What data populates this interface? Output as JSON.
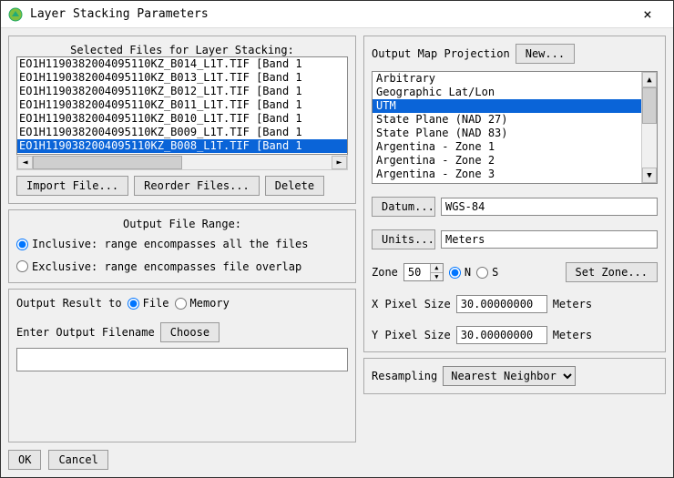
{
  "window": {
    "title": "Layer Stacking Parameters",
    "close": "×"
  },
  "left": {
    "files_heading": "Selected Files for Layer Stacking:",
    "files": [
      "EO1H1190382004095110KZ_B014_L1T.TIF [Band 1",
      "EO1H1190382004095110KZ_B013_L1T.TIF [Band 1",
      "EO1H1190382004095110KZ_B012_L1T.TIF [Band 1",
      "EO1H1190382004095110KZ_B011_L1T.TIF [Band 1",
      "EO1H1190382004095110KZ_B010_L1T.TIF [Band 1",
      "EO1H1190382004095110KZ_B009_L1T.TIF [Band 1",
      "EO1H1190382004095110KZ_B008_L1T.TIF [Band 1"
    ],
    "selected_file_index": 6,
    "import": "Import File...",
    "reorder": "Reorder Files...",
    "delete": "Delete",
    "range_heading": "Output File Range:",
    "range_inclusive": "Inclusive: range encompasses all the files",
    "range_exclusive": "Exclusive: range encompasses file overlap",
    "range_selected": "inclusive",
    "output_to_label": "Output Result to",
    "output_file": "File",
    "output_memory": "Memory",
    "output_selected": "file",
    "enter_filename_label": "Enter Output Filename",
    "choose": "Choose",
    "filename_value": ""
  },
  "right": {
    "projection_label": "Output Map Projection",
    "new_btn": "New...",
    "projections": [
      "Arbitrary",
      "Geographic Lat/Lon",
      "UTM",
      "State Plane (NAD 27)",
      "State Plane (NAD 83)",
      "Argentina - Zone 1",
      "Argentina - Zone 2",
      "Argentina - Zone 3"
    ],
    "projection_selected_index": 2,
    "datum_btn": "Datum...",
    "datum_value": "WGS-84",
    "units_btn": "Units...",
    "units_value": "Meters",
    "zone_label": "Zone",
    "zone_value": "50",
    "zone_n": "N",
    "zone_s": "S",
    "zone_hemi": "N",
    "set_zone": "Set Zone...",
    "x_pixel_label": "X Pixel Size",
    "x_pixel_value": "30.00000000",
    "y_pixel_label": "Y Pixel Size",
    "y_pixel_value": "30.00000000",
    "pixel_units": "Meters",
    "resampling_label": "Resampling",
    "resampling_value": "Nearest Neighbor"
  },
  "buttons": {
    "ok": "OK",
    "cancel": "Cancel"
  }
}
